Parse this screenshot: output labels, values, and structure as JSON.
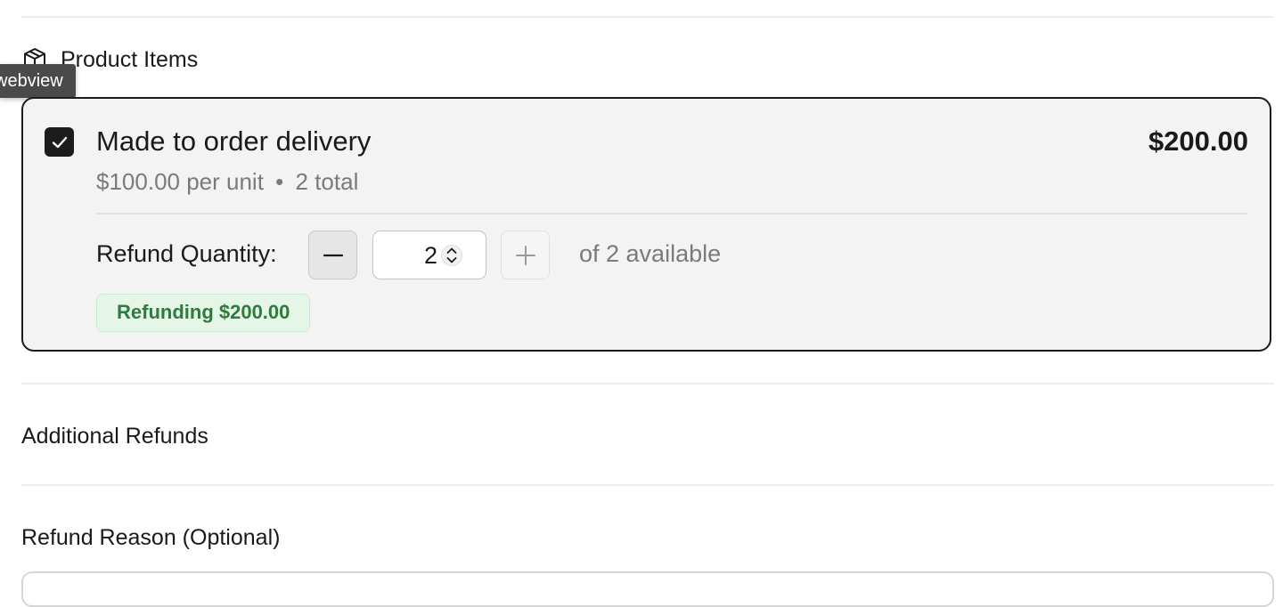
{
  "product_items": {
    "heading": "Product Items",
    "icon": "package-icon"
  },
  "tooltip": {
    "label": "webview"
  },
  "item": {
    "title": "Made to order delivery",
    "total": "$200.00",
    "unit_price": "$100.00 per unit",
    "separator": "•",
    "quantity_total": "2 total",
    "checked": true
  },
  "refund_quantity": {
    "label": "Refund Quantity:",
    "value": "2",
    "available": "of 2 available",
    "minus_icon": "minus-icon",
    "plus_icon": "plus-icon"
  },
  "refund_badge": {
    "label": "Refunding $200.00",
    "color": "#2f7a3d"
  },
  "additional_refunds": {
    "heading": "Additional Refunds"
  },
  "refund_reason": {
    "heading": "Refund Reason (Optional)"
  }
}
